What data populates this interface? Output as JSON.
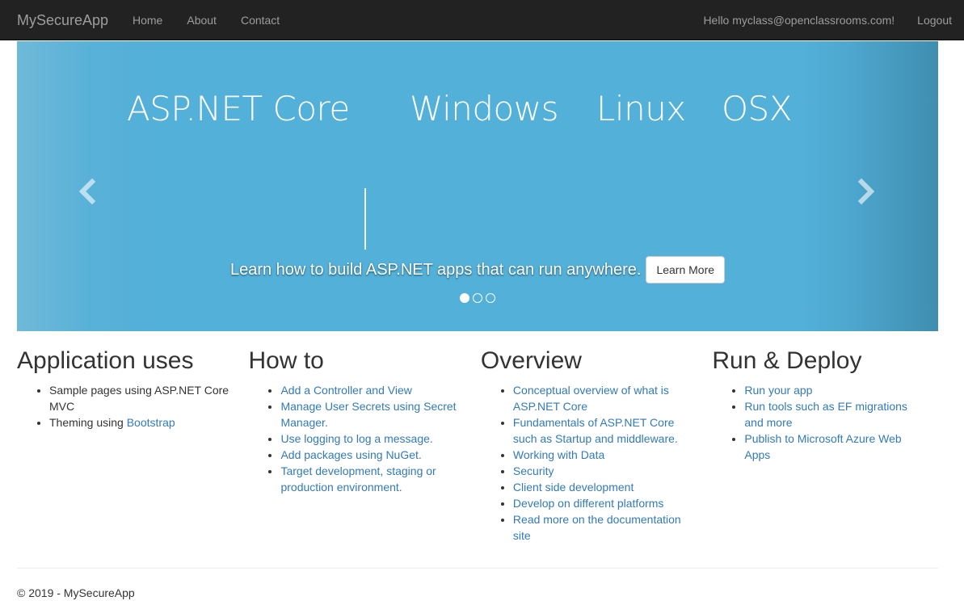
{
  "navbar": {
    "brand": "MySecureApp",
    "links": [
      "Home",
      "About",
      "Contact"
    ],
    "hello": "Hello myclass@openclassrooms.com!",
    "logout": "Logout"
  },
  "carousel": {
    "hero": [
      "ASP.NET Core",
      "Windows",
      "Linux",
      "OSX"
    ],
    "caption": "Learn how to build ASP.NET apps that can run anywhere.",
    "button": "Learn More",
    "prev_icon": "chevron-left-icon",
    "next_icon": "chevron-right-icon",
    "slides": 3,
    "active_slide": 1
  },
  "columns": [
    {
      "title": "Application uses",
      "items": [
        {
          "text": "Sample pages using ASP.NET Core MVC"
        },
        {
          "text": "Theming using ",
          "link": "Bootstrap"
        }
      ]
    },
    {
      "title": "How to",
      "items": [
        {
          "link": "Add a Controller and View"
        },
        {
          "link": "Manage User Secrets using Secret Manager."
        },
        {
          "link": "Use logging to log a message."
        },
        {
          "link": "Add packages using NuGet."
        },
        {
          "link": "Target development, staging or production environment."
        }
      ]
    },
    {
      "title": "Overview",
      "items": [
        {
          "link": "Conceptual overview of what is ASP.NET Core"
        },
        {
          "link": "Fundamentals of ASP.NET Core such as Startup and middleware."
        },
        {
          "link": "Working with Data"
        },
        {
          "link": "Security"
        },
        {
          "link": "Client side development"
        },
        {
          "link": "Develop on different platforms"
        },
        {
          "link": "Read more on the documentation site"
        }
      ]
    },
    {
      "title": "Run & Deploy",
      "items": [
        {
          "link": "Run your app"
        },
        {
          "link": "Run tools such as EF migrations and more"
        },
        {
          "link": "Publish to Microsoft Azure Web Apps"
        }
      ]
    }
  ],
  "footer": "© 2019 - MySecureApp",
  "colors": {
    "navbar": "#222222",
    "link": "#337ab7",
    "carousel": "#53b0d8"
  }
}
